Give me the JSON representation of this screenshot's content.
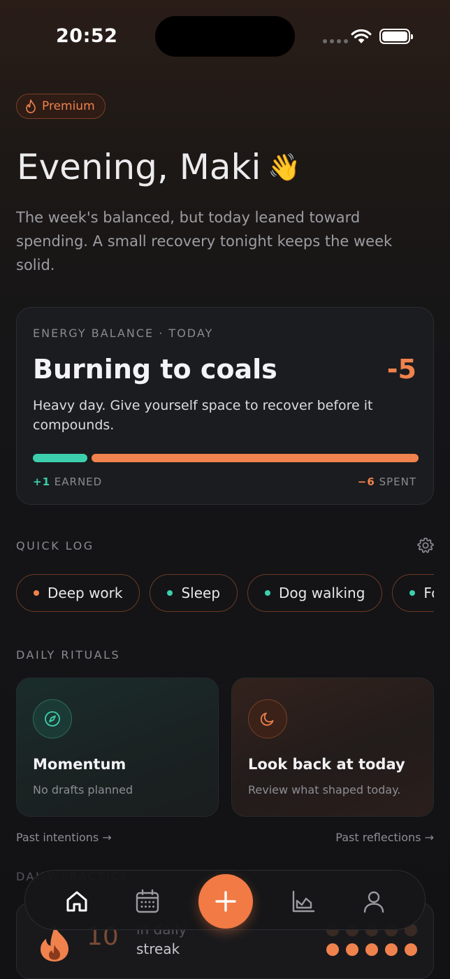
{
  "status_bar": {
    "time": "20:52"
  },
  "badge": {
    "label": "Premium",
    "icon": "flame-icon"
  },
  "greeting": {
    "text": "Evening, Maki",
    "emoji": "👋"
  },
  "intro": "The week's balanced, but today leaned toward spending. A small recovery tonight keeps the week solid.",
  "energy": {
    "eyebrow": "ENERGY BALANCE · TODAY",
    "title": "Burning to coals",
    "score": "-5",
    "description": "Heavy day. Give yourself space to recover before it compounds.",
    "earned_value": "+1",
    "earned_label": "EARNED",
    "spent_value": "−6",
    "spent_label": "SPENT",
    "earned_fraction": 0.143,
    "colors": {
      "earned": "#3ccfae",
      "spent": "#f0824d"
    }
  },
  "quick_log": {
    "label": "QUICK LOG",
    "settings_icon": "gear-icon",
    "chips": [
      {
        "label": "Deep work",
        "dot": "#f0824d"
      },
      {
        "label": "Sleep",
        "dot": "#3ccfae"
      },
      {
        "label": "Dog walking",
        "dot": "#3ccfae"
      },
      {
        "label": "Food",
        "dot": "#3ccfae"
      }
    ]
  },
  "rituals": {
    "label": "DAILY RITUALS",
    "left": {
      "title": "Momentum",
      "subtitle": "No drafts planned",
      "icon": "compass-icon"
    },
    "right": {
      "title": "Look back at today",
      "subtitle": "Review what shaped today.",
      "icon": "moon-icon"
    },
    "past_left": "Past intentions →",
    "past_right": "Past reflections →"
  },
  "practice": {
    "label": "DAILY PRACTICE",
    "streak_number": "10",
    "streak_line1": "in daily",
    "streak_line2": "streak",
    "streak_icon": "flame-icon"
  },
  "tabbar": {
    "tabs": [
      "home-icon",
      "calendar-icon",
      "plus-icon",
      "chart-icon",
      "profile-icon"
    ],
    "accent": "#f27a45"
  }
}
